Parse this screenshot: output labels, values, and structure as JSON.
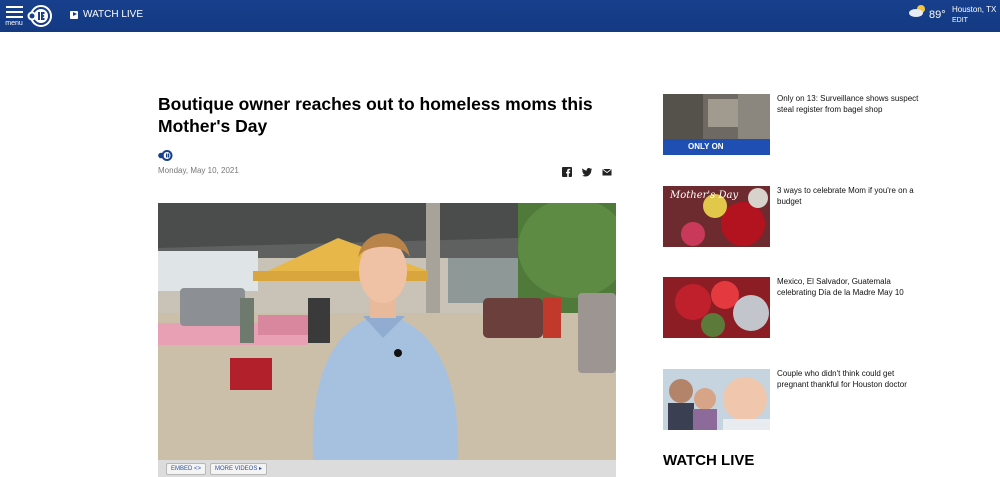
{
  "header": {
    "menu_label": "menu",
    "watch_live": "WATCH LIVE",
    "weather": {
      "temp": "89°",
      "city": "Houston, TX",
      "edit": "EDIT"
    },
    "brand_color": "#173f8c"
  },
  "article": {
    "headline": "Boutique owner reaches out to homeless moms this Mother's Day",
    "date": "Monday, May 10, 2021",
    "video": {
      "embed_label": "EMBED <>",
      "more_videos_label": "MORE VIDEOS"
    }
  },
  "sidebar": {
    "stories": [
      {
        "title": "Only on 13: Surveillance shows suspect steal register from bagel shop",
        "badge": "ONLY ON"
      },
      {
        "title": "3 ways to celebrate Mom if you're on a budget",
        "card_text": "Mother's Day"
      },
      {
        "title": "Mexico, El Salvador, Guatemala celebrating Día de la Madre May 10"
      },
      {
        "title": "Couple who didn't think could get pregnant thankful for Houston doctor"
      }
    ],
    "watch_live_heading": "WATCH LIVE"
  }
}
